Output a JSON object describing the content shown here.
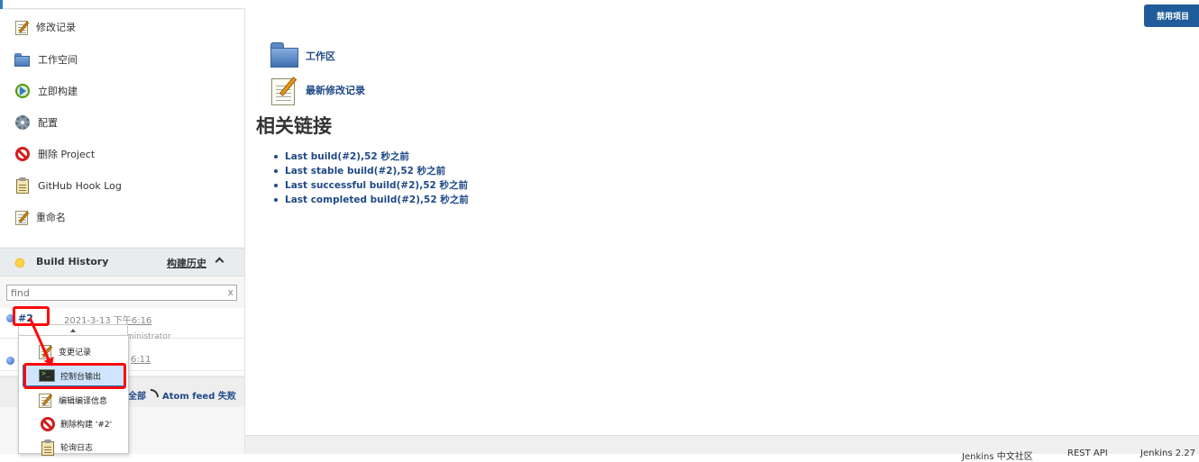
{
  "sidebar": {
    "tasks": [
      {
        "label": "修改记录",
        "icon": "notepad-icon"
      },
      {
        "label": "工作空间",
        "icon": "folder-icon"
      },
      {
        "label": "立即构建",
        "icon": "build-now-icon"
      },
      {
        "label": "配置",
        "icon": "gear-icon"
      },
      {
        "label": "删除 Project",
        "icon": "delete-icon"
      },
      {
        "label": "GitHub Hook Log",
        "icon": "clipboard-icon"
      },
      {
        "label": "重命名",
        "icon": "notepad-icon"
      }
    ]
  },
  "build_history": {
    "title": "Build History",
    "trend_label": "构建历史",
    "search_placeholder": "find",
    "clear_label": "x",
    "builds": [
      {
        "number": "#2",
        "date": "2021-3-13 下午6:16",
        "user": "ministrator"
      },
      {
        "number": "",
        "date": "6:11",
        "user": ""
      }
    ],
    "feed_all": "全部",
    "feed_failures": "Atom feed 失败"
  },
  "context_menu": {
    "items": [
      {
        "label": "变更记录",
        "icon": "notepad-icon"
      },
      {
        "label": "控制台输出",
        "icon": "terminal-icon",
        "selected": true
      },
      {
        "label": "编辑编译信息",
        "icon": "notepad-icon"
      },
      {
        "label": "删除构建 '#2'",
        "icon": "delete-icon"
      },
      {
        "label": "轮询日志",
        "icon": "clipboard-icon"
      }
    ]
  },
  "main": {
    "disable_button": "禁用项目",
    "workspace_link": "工作区",
    "recent_changes_link": "最新修改记录",
    "related_title": "相关链接",
    "related_links": [
      "Last build(#2),52 秒之前",
      "Last stable build(#2),52 秒之前",
      "Last successful build(#2),52 秒之前",
      "Last completed build(#2),52 秒之前"
    ]
  },
  "footer": {
    "community": "Jenkins 中文社区",
    "rest_api": "REST API",
    "version": "Jenkins 2.27"
  },
  "colors": {
    "link": "#204a87",
    "accent_button": "#1f5c99",
    "annotation": "#ff0a0a"
  }
}
